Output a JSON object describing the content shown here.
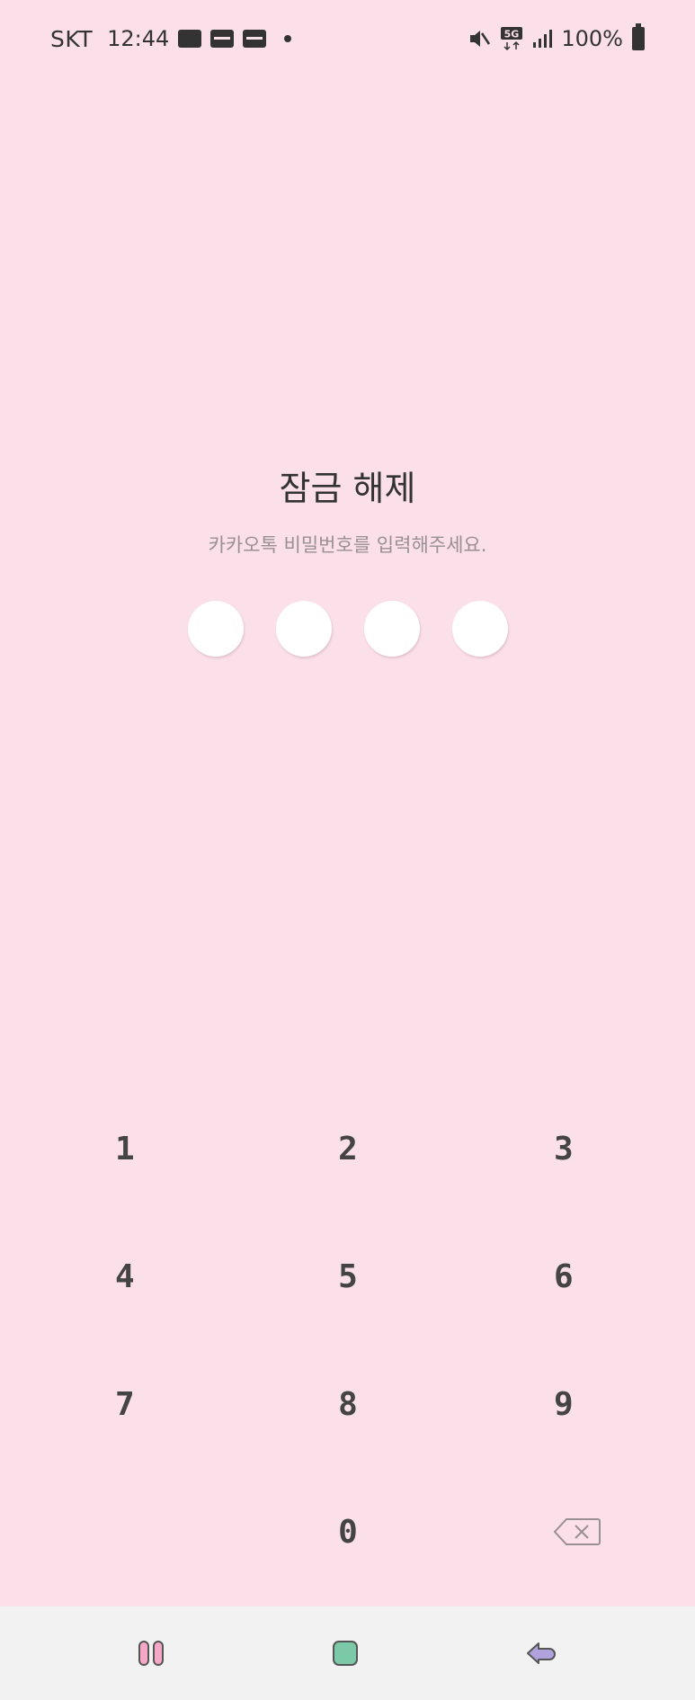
{
  "status_bar": {
    "carrier": "SKT",
    "time": "12:44",
    "battery": "100%",
    "network": "5G",
    "icons": [
      "note-icon",
      "webtoon-icon",
      "webtoon-icon",
      "dot-icon",
      "mute-icon",
      "5g-icon",
      "signal-icon",
      "battery-icon"
    ]
  },
  "lock": {
    "title": "잠금 해제",
    "subtitle": "카카오톡 비밀번호를 입력해주세요.",
    "pin_length": 4,
    "pin_entered": 0
  },
  "keypad": {
    "keys": [
      "1",
      "2",
      "3",
      "4",
      "5",
      "6",
      "7",
      "8",
      "9",
      "",
      "0",
      "backspace"
    ]
  },
  "nav_bar": {
    "buttons": [
      "recents-icon",
      "home-icon",
      "back-icon"
    ]
  },
  "colors": {
    "background": "#fbdfe9",
    "nav_background": "#f2f2f2",
    "recents": "#f4a7c6",
    "home": "#7cc9a7",
    "back": "#b0a2dc"
  }
}
